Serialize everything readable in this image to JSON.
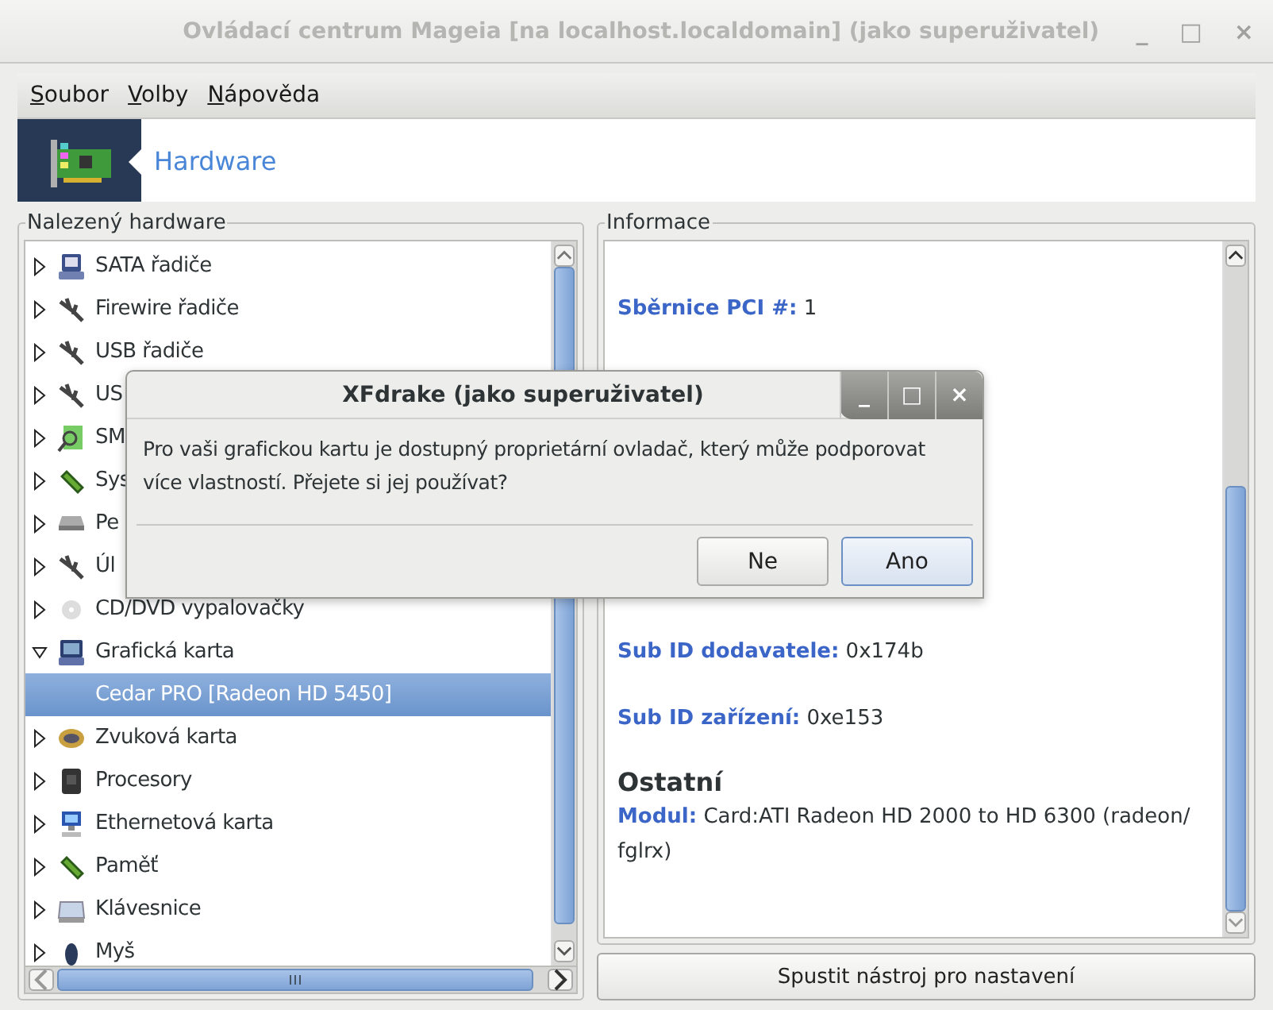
{
  "window": {
    "title": "Ovládací centrum Mageia  [na localhost.localdomain] (jako superuživatel)",
    "controls": [
      "_",
      "□",
      "×"
    ]
  },
  "menu": [
    {
      "label": "Soubor"
    },
    {
      "label": "Volby"
    },
    {
      "label": "Nápověda"
    }
  ],
  "banner": {
    "title": "Hardware"
  },
  "hardware": {
    "title": "Nalezený hardware",
    "items": [
      {
        "label": "SATA řadiče",
        "expanded": false
      },
      {
        "label": "Firewire řadiče",
        "expanded": false
      },
      {
        "label": "USB řadiče",
        "expanded": false
      },
      {
        "label": "US",
        "expanded": false
      },
      {
        "label": "SM",
        "expanded": false
      },
      {
        "label": "Sys",
        "expanded": false
      },
      {
        "label": "Pe",
        "expanded": false
      },
      {
        "label": "Úl",
        "expanded": false
      },
      {
        "label": "CD/DVD vypalovačky",
        "expanded": false
      },
      {
        "label": "Grafická karta",
        "expanded": true,
        "children": [
          {
            "label": "Cedar PRO [Radeon HD 5450]",
            "selected": true
          }
        ]
      },
      {
        "label": "Zvuková karta",
        "expanded": false
      },
      {
        "label": "Procesory",
        "expanded": false
      },
      {
        "label": "Ethernetová karta",
        "expanded": false
      },
      {
        "label": "Paměť",
        "expanded": false
      },
      {
        "label": "Klávesnice",
        "expanded": false
      },
      {
        "label": "Myš",
        "expanded": false
      }
    ]
  },
  "info": {
    "title": "Informace",
    "fields": [
      {
        "label": "Sběrnice PCI #:",
        "value": "1"
      },
      {
        "label": "Sub ID dodavatele:",
        "value": "0x174b"
      },
      {
        "label": "Sub ID zařízení:",
        "value": "0xe153"
      }
    ],
    "section": "Ostatní",
    "module": {
      "label": "Modul:",
      "value": "Card:ATI Radeon HD 2000 to HD 6300 (radeon/ fglrx)"
    }
  },
  "configure_button": "Spustit nástroj pro nastavení",
  "dialog": {
    "title": "XFdrake (jako superuživatel)",
    "controls": [
      "_",
      "□",
      "×"
    ],
    "message": "Pro vaši grafickou kartu je dostupný proprietární ovladač, který může podporovat více vlastností. Přejete si jej používat?",
    "buttons": [
      {
        "label": "Ne",
        "default": false
      },
      {
        "label": "Ano",
        "default": true
      }
    ]
  }
}
